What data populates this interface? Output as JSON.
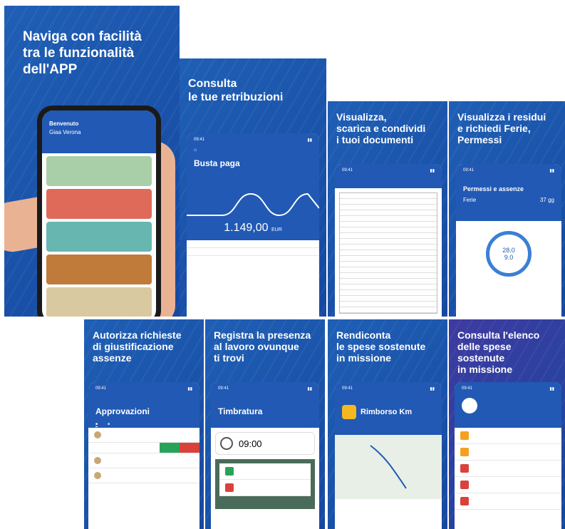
{
  "panels": {
    "p1": "Naviga con facilità\ntra le funzionalità\ndell'APP",
    "p2": "Consulta\nle tue retribuzioni",
    "p3": "Visualizza,\nscarica e condividi\ni tuoi documenti",
    "p4": "Visualizza i residui\ne richiedi Ferie,\nPermessi",
    "p5": "Autorizza richieste\ndi giustificazione\nassenze",
    "p6": "Registra la presenza\nal lavoro ovunque\nti trovi",
    "p7": "Rendiconta\nle spese sostenute\nin missione",
    "p8": "Consulta l'elenco\ndelle spese sostenute\nin missione"
  },
  "home": {
    "welcome": "Benvenuto",
    "name": "Giaa Verona"
  },
  "busta": {
    "title": "Busta paga",
    "amount": "1.149,00",
    "currency": "EUR"
  },
  "ferie": {
    "title": "Permessi e assenze",
    "label": "Ferie",
    "days": "37",
    "unit": "gg",
    "residuo": "28.0",
    "goduti": "9.0"
  },
  "approv": {
    "title": "Approvazioni"
  },
  "timbra": {
    "title": "Timbratura",
    "time": "09:00"
  },
  "rimborso": {
    "title": "Rimborso Km"
  },
  "colors": {
    "brand": "#2159b4",
    "bg_blue": "#1648a0"
  }
}
